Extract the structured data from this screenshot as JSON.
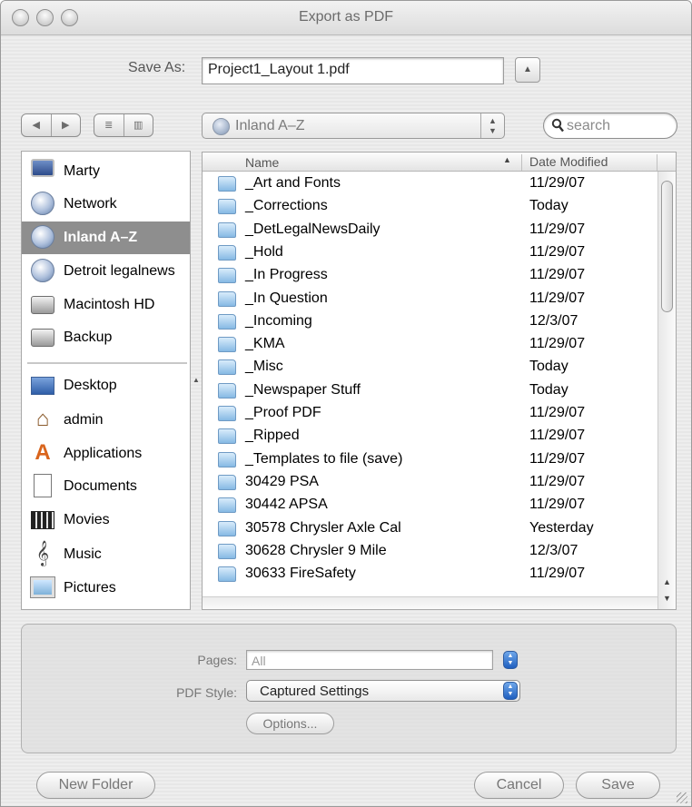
{
  "window": {
    "title": "Export as PDF"
  },
  "save_as": {
    "label": "Save As:",
    "value": "Project1_Layout 1.pdf"
  },
  "toolbar": {
    "path_popup": "Inland A–Z",
    "search_placeholder": "search"
  },
  "sidebar": {
    "devices": [
      {
        "label": "Marty",
        "icon": "computer-icon"
      },
      {
        "label": "Network",
        "icon": "network-globe-icon"
      },
      {
        "label": "Inland A–Z",
        "icon": "network-volume-icon",
        "selected": true
      },
      {
        "label": "Detroit legalnews",
        "icon": "network-volume-icon"
      },
      {
        "label": "Macintosh HD",
        "icon": "hard-drive-icon"
      },
      {
        "label": "Backup",
        "icon": "hard-drive-icon"
      }
    ],
    "places": [
      {
        "label": "Desktop",
        "icon": "desktop-icon"
      },
      {
        "label": "admin",
        "icon": "home-icon"
      },
      {
        "label": "Applications",
        "icon": "applications-icon"
      },
      {
        "label": "Documents",
        "icon": "document-icon"
      },
      {
        "label": "Movies",
        "icon": "clapperboard-icon"
      },
      {
        "label": "Music",
        "icon": "treble-clef-icon"
      },
      {
        "label": "Pictures",
        "icon": "pictures-icon"
      }
    ]
  },
  "file_list": {
    "columns": {
      "name": "Name",
      "date": "Date Modified"
    },
    "rows": [
      {
        "name": "_Art and Fonts",
        "date": "11/29/07"
      },
      {
        "name": "_Corrections",
        "date": "Today"
      },
      {
        "name": "_DetLegalNewsDaily",
        "date": "11/29/07"
      },
      {
        "name": "_Hold",
        "date": "11/29/07"
      },
      {
        "name": "_In Progress",
        "date": "11/29/07"
      },
      {
        "name": "_In Question",
        "date": "11/29/07"
      },
      {
        "name": "_Incoming",
        "date": "12/3/07"
      },
      {
        "name": "_KMA",
        "date": "11/29/07"
      },
      {
        "name": "_Misc",
        "date": "Today"
      },
      {
        "name": "_Newspaper Stuff",
        "date": "Today"
      },
      {
        "name": "_Proof PDF",
        "date": "11/29/07"
      },
      {
        "name": "_Ripped",
        "date": "11/29/07"
      },
      {
        "name": "_Templates to file (save)",
        "date": "11/29/07"
      },
      {
        "name": "30429 PSA",
        "date": "11/29/07"
      },
      {
        "name": "30442 APSA",
        "date": "11/29/07"
      },
      {
        "name": "30578 Chrysler Axle Cal",
        "date": "Yesterday"
      },
      {
        "name": "30628 Chrysler 9 Mile",
        "date": "12/3/07"
      },
      {
        "name": "30633 FireSafety",
        "date": "11/29/07"
      }
    ]
  },
  "options": {
    "pages_label": "Pages:",
    "pages_value": "All",
    "style_label": "PDF Style:",
    "style_value": "Captured Settings",
    "options_button": "Options..."
  },
  "buttons": {
    "new_folder": "New Folder",
    "cancel": "Cancel",
    "save": "Save"
  }
}
